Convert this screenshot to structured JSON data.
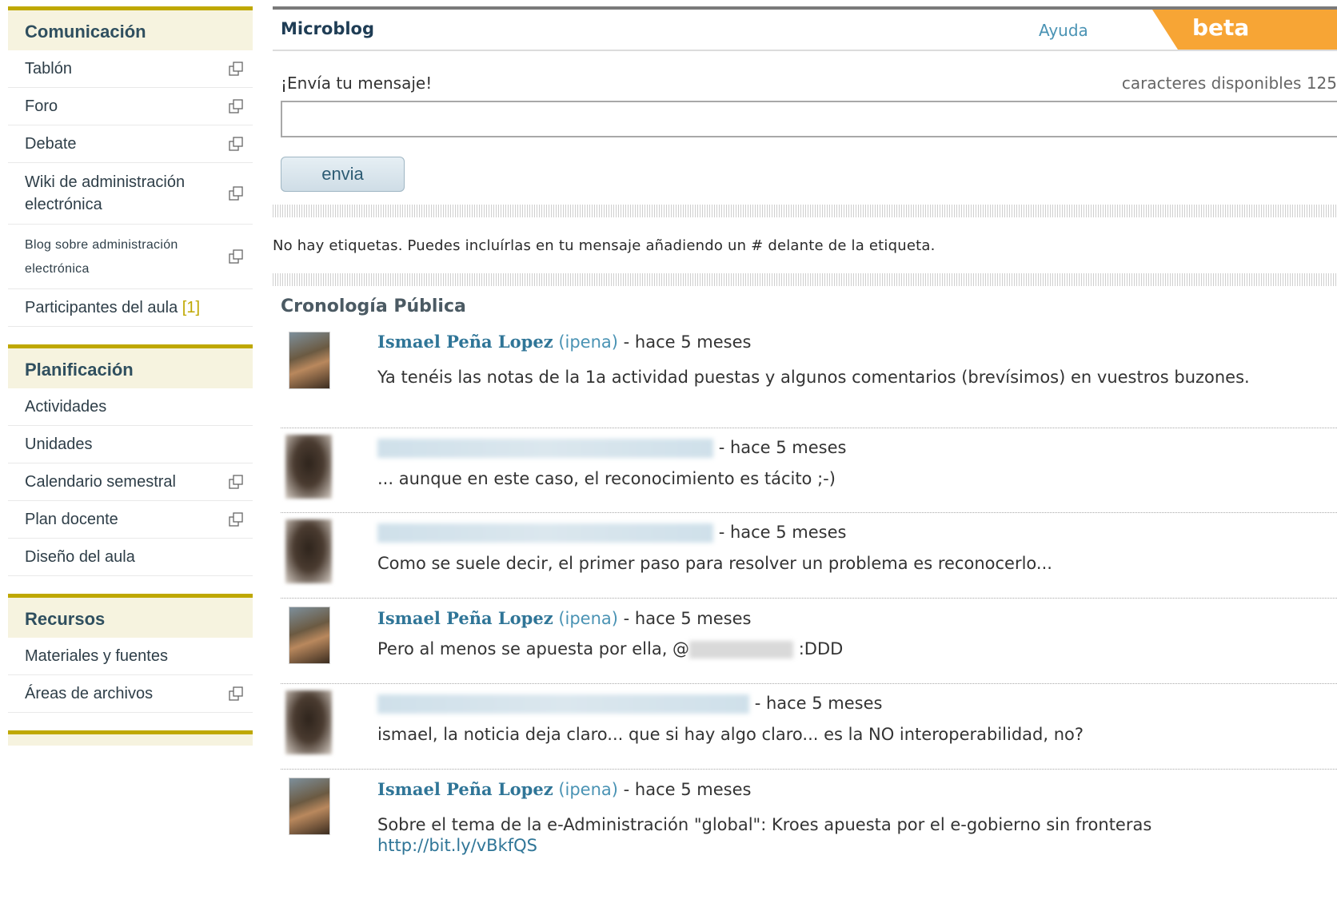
{
  "sidebar": {
    "blocks": [
      {
        "title": "Comunicación",
        "items": [
          {
            "label": "Tablón"
          },
          {
            "label": "Foro"
          },
          {
            "label": "Debate"
          },
          {
            "label": "Wiki de administración electrónica"
          },
          {
            "label": "Blog sobre administración electrónica"
          },
          {
            "label": "Participantes del aula",
            "count": "[1]"
          }
        ]
      },
      {
        "title": "Planificación",
        "items": [
          {
            "label": "Actividades"
          },
          {
            "label": "Unidades"
          },
          {
            "label": "Calendario semestral"
          },
          {
            "label": "Plan docente"
          },
          {
            "label": "Diseño del aula"
          }
        ]
      },
      {
        "title": "Recursos",
        "items": [
          {
            "label": "Materiales y fuentes"
          },
          {
            "label": "Áreas de archivos"
          }
        ]
      }
    ]
  },
  "header": {
    "title": "Microblog",
    "help": "Ayuda",
    "badge": "beta"
  },
  "compose": {
    "label": "¡Envía tu mensaje!",
    "chars_label": "caracteres disponibles",
    "chars_count": "125",
    "input_value": "",
    "send_label": "envia"
  },
  "tags_note": "No hay etiquetas. Puedes incluírlas en tu mensaje añadiendo un # delante de la etiqueta.",
  "timeline": {
    "title": "Cronología Pública",
    "posts": [
      {
        "author": "Ismael Peña Lopez",
        "handle": "(ipena)",
        "time": "- hace 5 meses",
        "text": "Ya tenéis las notas de la 1a actividad puestas y algunos comentarios (brevísimos) en vuestros buzones."
      },
      {
        "author": "",
        "handle": "",
        "time": "- hace 5 meses",
        "text": "... aunque en este caso, el reconocimiento es tácito ;-)"
      },
      {
        "author": "",
        "handle": "",
        "time": "- hace 5 meses",
        "text": "Como se suele decir, el primer paso para resolver un problema es reconocerlo..."
      },
      {
        "author": "Ismael Peña Lopez",
        "handle": "(ipena)",
        "time": "- hace 5 meses",
        "text_before": "Pero al menos se apuesta por ella, @",
        "text_after": ":DDD"
      },
      {
        "author": "",
        "handle": "",
        "time": "- hace 5 meses",
        "text": "ismael, la noticia deja claro... que si hay algo claro... es la NO interoperabilidad, no?"
      },
      {
        "author": "Ismael Peña Lopez",
        "handle": "(ipena)",
        "time": "- hace 5 meses",
        "text": "Sobre el tema de la e-Administración \"global\": Kroes apuesta por el e-gobierno sin fronteras",
        "link": "http://bit.ly/vBkfQS"
      }
    ]
  }
}
